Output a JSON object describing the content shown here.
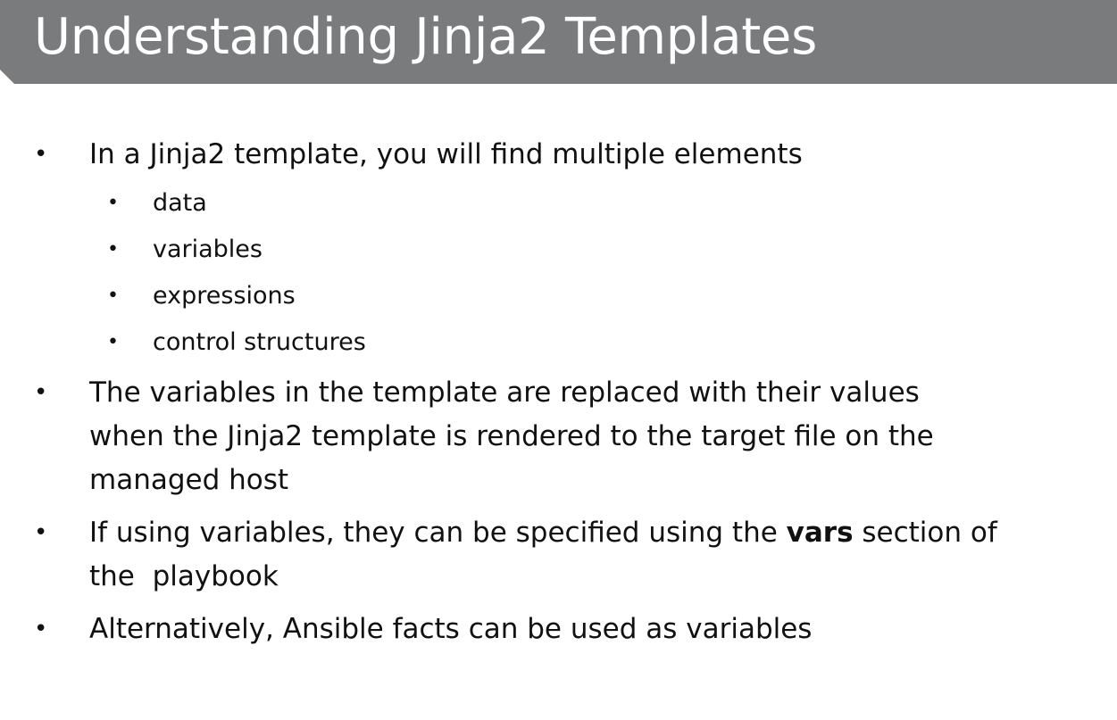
{
  "title": "Understanding Jinja2 Templates",
  "bullets": [
    {
      "text": "In a Jinja2 template, you will find multiple elements",
      "subitems": [
        "data",
        "variables",
        "expressions",
        "control structures"
      ]
    },
    {
      "lines": [
        "The variables in the template are replaced with their values",
        "when the Jinja2 template is rendered to the target file on the",
        "managed host"
      ]
    },
    {
      "line1_before": "If using variables, they can be specified using the ",
      "line1_bold": "vars",
      "line1_after": " section of",
      "line2": "the  playbook"
    },
    {
      "text": "Alternatively, Ansible facts can be used as variables"
    }
  ],
  "bullet_char": "•"
}
